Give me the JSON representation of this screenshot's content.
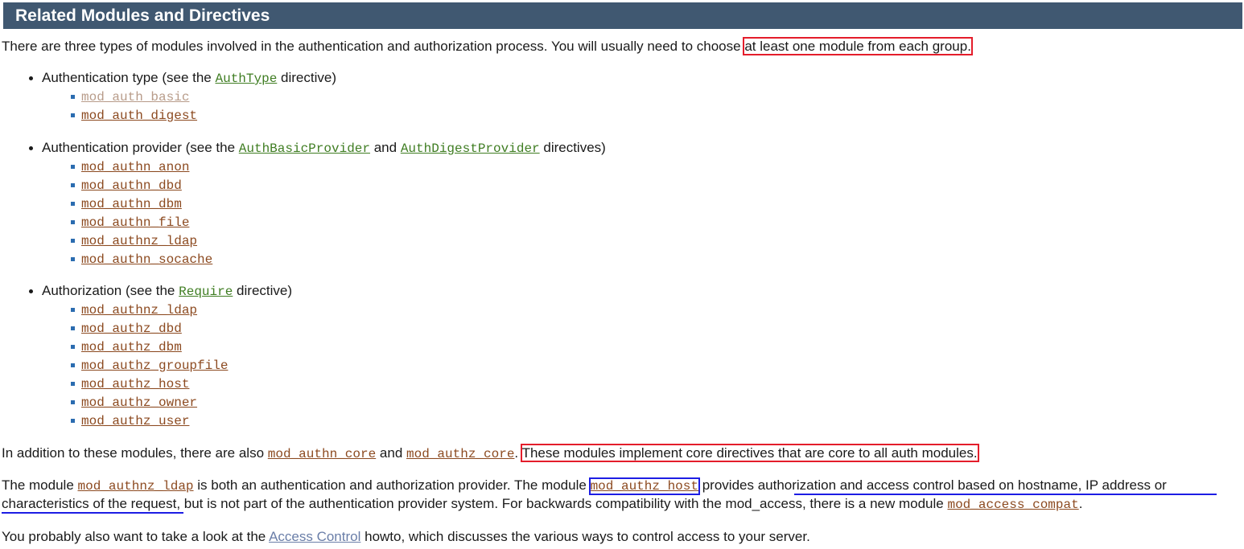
{
  "section": {
    "title": "Related Modules and Directives"
  },
  "intro": {
    "text": "There are three types of modules involved in the authentication and authorization process. You will usually need to choose ",
    "highlight": "at least one module from each group."
  },
  "groups": [
    {
      "label": "Authentication type (see the ",
      "directives": [
        "AuthType"
      ],
      "joiner": "",
      "suffix": " directive)",
      "modules": [
        "mod_auth_basic",
        "mod_auth_digest"
      ]
    },
    {
      "label": "Authentication provider (see the ",
      "directives": [
        "AuthBasicProvider",
        "AuthDigestProvider"
      ],
      "joiner": " and ",
      "suffix": " directives)",
      "modules": [
        "mod_authn_anon",
        "mod_authn_dbd",
        "mod_authn_dbm",
        "mod_authn_file",
        "mod_authnz_ldap",
        "mod_authn_socache"
      ]
    },
    {
      "label": "Authorization (see the ",
      "directives": [
        "Require"
      ],
      "joiner": "",
      "suffix": " directive)",
      "modules": [
        "mod_authnz_ldap",
        "mod_authz_dbd",
        "mod_authz_dbm",
        "mod_authz_groupfile",
        "mod_authz_host",
        "mod_authz_owner",
        "mod_authz_user"
      ]
    }
  ],
  "addition": {
    "prefix": "In addition to these modules, there are also ",
    "mod1": "mod_authn_core",
    "and": " and ",
    "mod2": "mod_authz_core",
    "dot": ".",
    "highlight": "These modules implement core directives that are core to all auth modules."
  },
  "provider": {
    "p1": "The module ",
    "mod1": "mod_authnz_ldap",
    "p2": " is both an authentication and authorization provider. The module",
    "mod2": "mod_authz_host",
    "p3": "provides ",
    "underlined1": "authorization and access control based on hostname, IP address or",
    "underlined2": "characteristics of the request",
    "p4": ", but is not part of the authentication provider system. For backwards compatibility with the mod_access, there is a new module ",
    "mod3": "mod_access_compat",
    "p5": "."
  },
  "closing": {
    "prefix": "You probably also want to take a look at the ",
    "link": "Access Control",
    "suffix": " howto, which discusses the various ways to control access to your server."
  }
}
